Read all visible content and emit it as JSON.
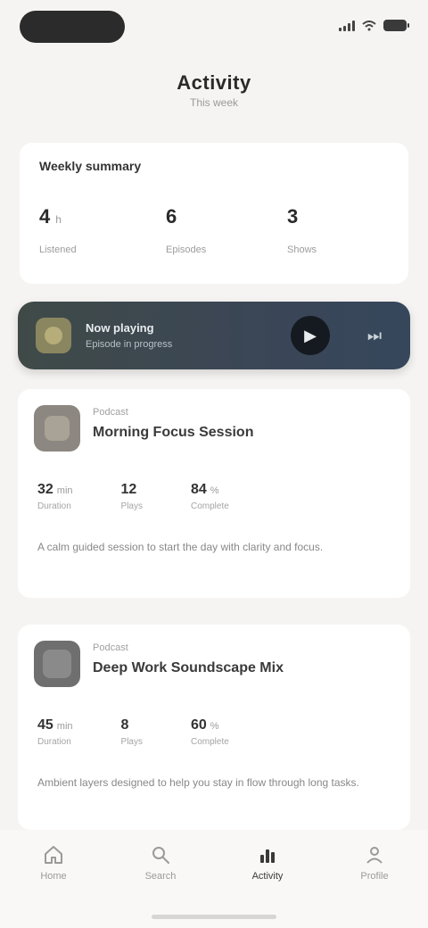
{
  "status_bar": {
    "time": ""
  },
  "header": {
    "title": "Activity",
    "subtitle": "This week"
  },
  "summary": {
    "heading": "Weekly summary",
    "stats": [
      {
        "value": "4",
        "unit": "h",
        "label": "Listened"
      },
      {
        "value": "6",
        "unit": "",
        "label": "Episodes"
      },
      {
        "value": "3",
        "unit": "",
        "label": "Shows"
      }
    ]
  },
  "now_playing": {
    "title": "Now playing",
    "subtitle": "Episode in progress",
    "play_icon": "play-icon",
    "next_icon": "skip-forward-icon"
  },
  "cards": [
    {
      "meta": "Podcast",
      "title": "Morning Focus Session",
      "stats": [
        {
          "value": "32",
          "unit": "min",
          "label": "Duration"
        },
        {
          "value": "12",
          "unit": "",
          "label": "Plays"
        },
        {
          "value": "84",
          "unit": "%",
          "label": "Complete"
        }
      ],
      "description": "A calm guided session to start the day with clarity and focus."
    },
    {
      "meta": "Podcast",
      "title": "Deep Work Soundscape Mix",
      "stats": [
        {
          "value": "45",
          "unit": "min",
          "label": "Duration"
        },
        {
          "value": "8",
          "unit": "",
          "label": "Plays"
        },
        {
          "value": "60",
          "unit": "%",
          "label": "Complete"
        }
      ],
      "description": "Ambient layers designed to help you stay in flow through long tasks."
    }
  ],
  "tabs": [
    {
      "label": "Home",
      "icon": "home-icon"
    },
    {
      "label": "Search",
      "icon": "search-icon"
    },
    {
      "label": "Activity",
      "icon": "chart-icon",
      "active": true
    },
    {
      "label": "Profile",
      "icon": "person-icon"
    }
  ]
}
